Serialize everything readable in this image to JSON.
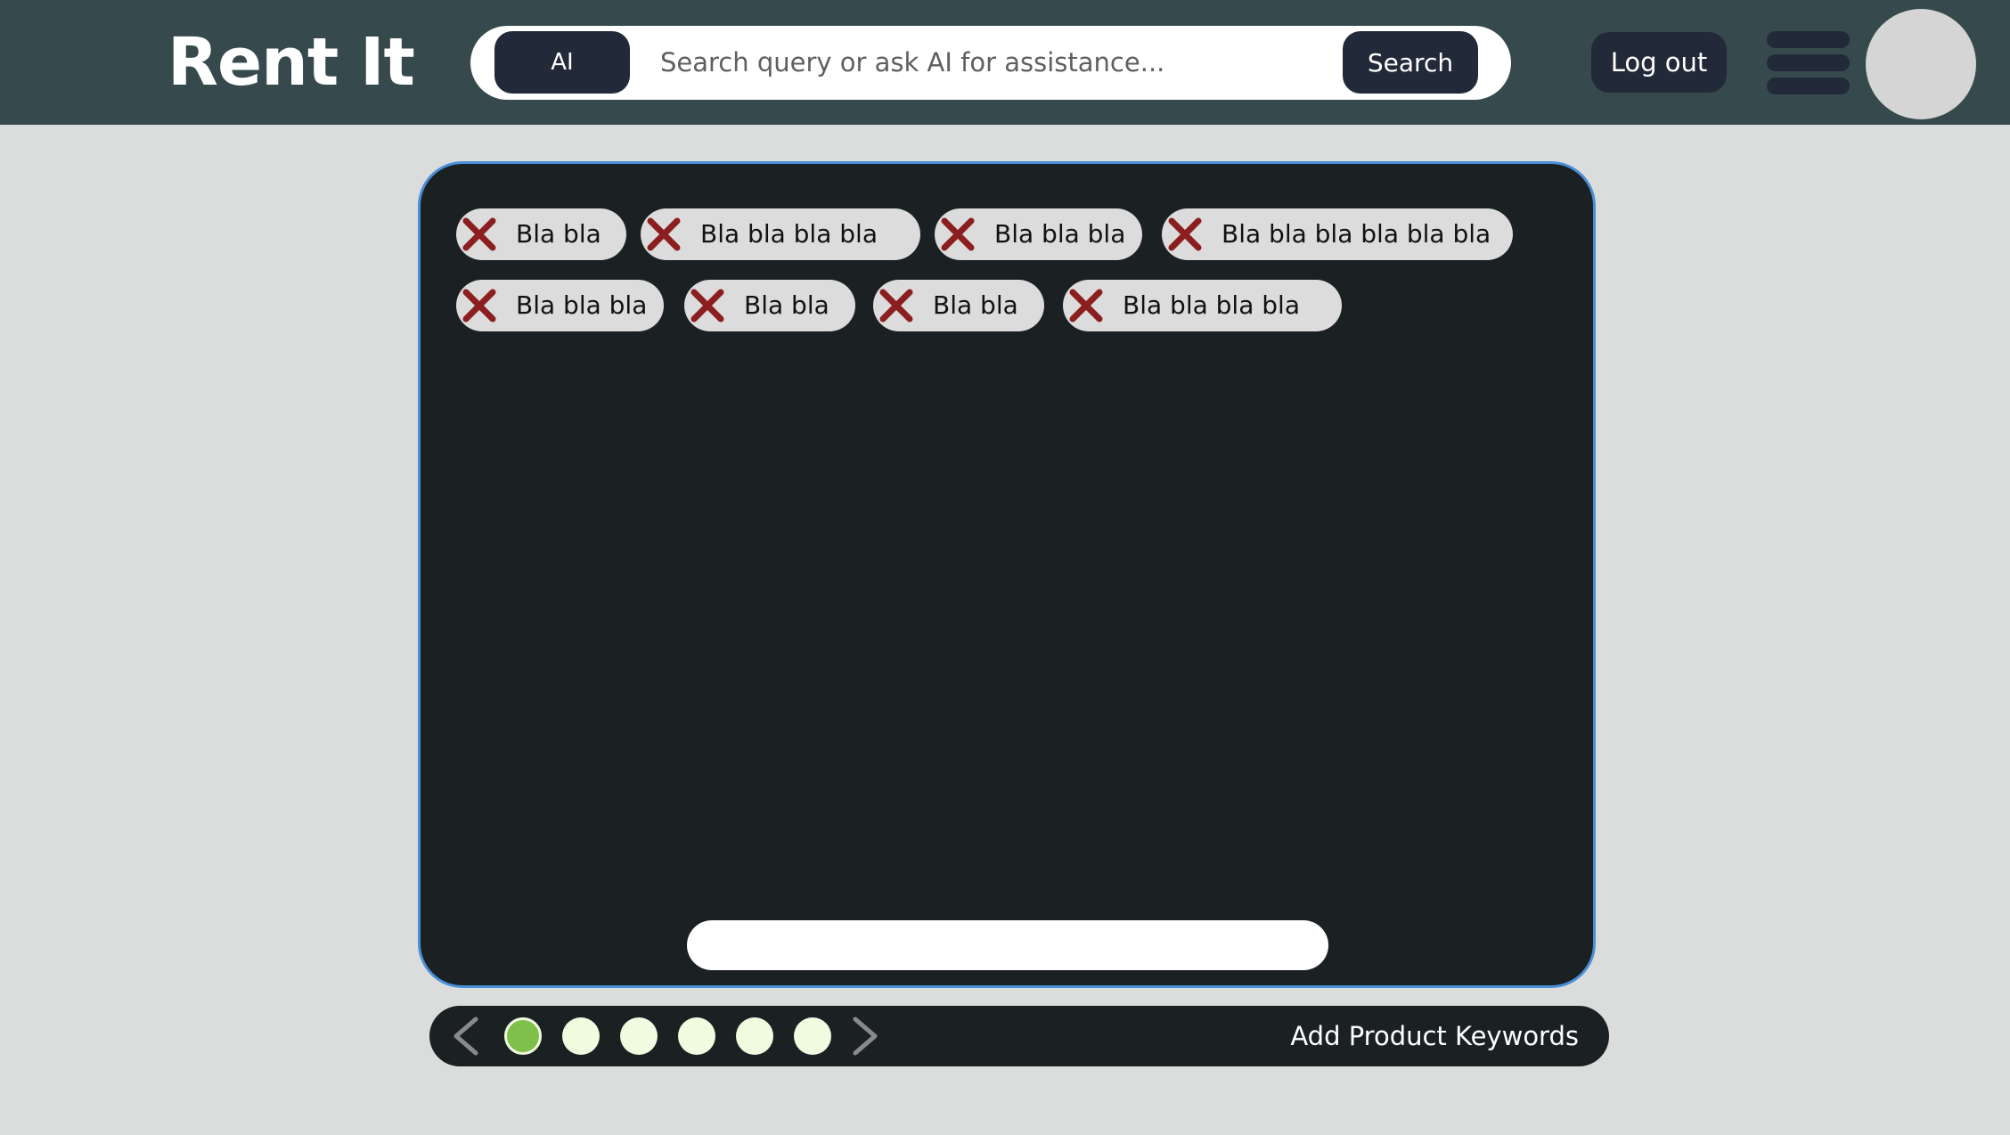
{
  "header": {
    "logo": "Rent It",
    "ai_label": "AI",
    "search_placeholder": "Search query or ask AI for assistance...",
    "search_label": "Search",
    "logout_label": "Log out"
  },
  "keywords": [
    "Bla bla",
    "Bla bla bla bla",
    "Bla bla bla",
    "Bla bla bla bla bla bla",
    "Bla bla bla",
    "Bla bla",
    "Bla bla",
    "Bla bla bla bla"
  ],
  "keyword_input": {
    "value": ""
  },
  "pager": {
    "total_steps": 6,
    "current_step": 1,
    "title": "Add Product Keywords"
  },
  "colors": {
    "header_bg": "#364a4d",
    "page_bg": "#dbdddc",
    "panel_bg": "#1b2123",
    "panel_border": "#4a90d9",
    "button_bg": "#222938",
    "chip_bg": "#dcdcdc",
    "remove_icon": "#8b1e1e",
    "dot_active": "#7ec04a",
    "dot_inactive": "#f0fbe0"
  },
  "icons": {
    "remove": "close-icon",
    "menu": "hamburger-menu-icon",
    "prev": "chevron-left-icon",
    "next": "chevron-right-icon"
  }
}
